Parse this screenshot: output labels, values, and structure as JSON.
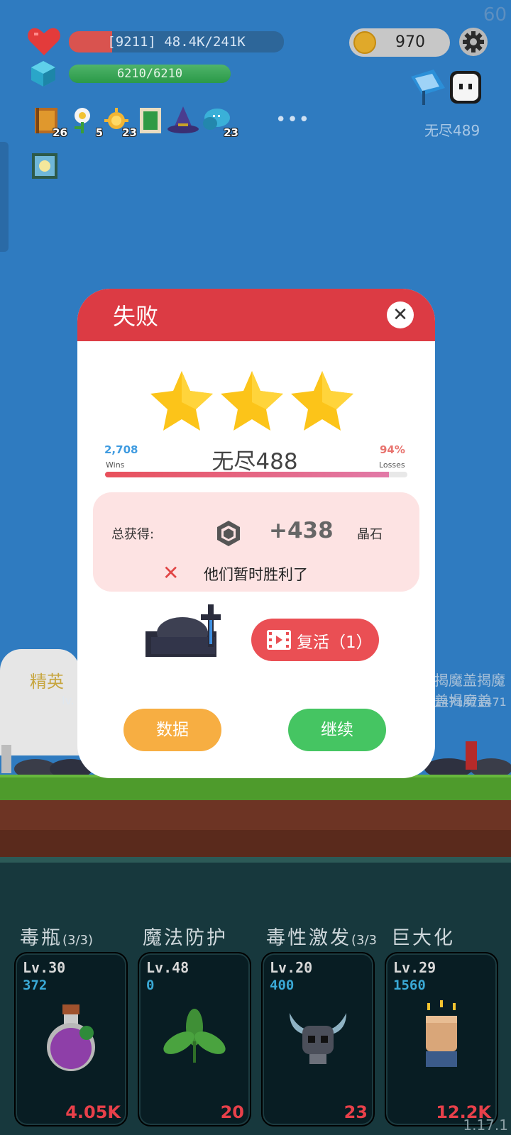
{
  "hud": {
    "fps": "60",
    "hp_text": "[9211] 48.4K/241K",
    "hp_fraction": 0.2,
    "mp_text": "6210/6210",
    "mp_fraction": 1.0,
    "coins": "970",
    "stage": "无尽489",
    "buffs": [
      {
        "icon": "book-icon",
        "count": "26"
      },
      {
        "icon": "flower-icon",
        "count": "5"
      },
      {
        "icon": "sun-icon",
        "count": "23"
      },
      {
        "icon": "card-icon",
        "count": ""
      },
      {
        "icon": "wizard-hat-icon",
        "count": ""
      },
      {
        "icon": "speech-bubble-icon",
        "count": "23"
      },
      {
        "icon": "glowing-tile-icon",
        "count": ""
      }
    ],
    "more": "•••"
  },
  "scene": {
    "elite_label": "精英",
    "lv_label": "lv.",
    "enemy_text": "揭魔盖揭魔盖揭魔盖",
    "enemy_nums": "1471471471"
  },
  "dialog": {
    "title": "失败",
    "stars": 3,
    "wins": "2,708",
    "wins_label": "Wins",
    "loss_pct": "94%",
    "loss_label": "Losses",
    "loss_fraction": 0.94,
    "stage_name": "无尽488",
    "total_label": "总获得:",
    "gem_amount": "+438",
    "gem_unit": "晶石",
    "defeat_msg": "他们暂时胜利了",
    "revive_label": "复活（1）",
    "data_label": "数据",
    "continue_label": "继续"
  },
  "skills": [
    {
      "name": "毒瓶",
      "suffix": "(3/3)",
      "lv": "Lv.30",
      "value": "372",
      "cost": "4.05K",
      "icon": "poison-bottle-icon"
    },
    {
      "name": "魔法防护",
      "suffix": "",
      "lv": "Lv.48",
      "value": "0",
      "cost": "20",
      "icon": "leaf-icon"
    },
    {
      "name": "毒性激发",
      "suffix": "(3/3",
      "lv": "Lv.20",
      "value": "400",
      "cost": "23",
      "icon": "horned-skull-icon"
    },
    {
      "name": "巨大化",
      "suffix": "",
      "lv": "Lv.29",
      "value": "1560",
      "cost": "12.2K",
      "icon": "fist-icon"
    }
  ],
  "version": "1.17.1",
  "colors": {
    "header_red": "#dc3b44",
    "star_yellow": "#fcc419",
    "revive_red": "#ea4f54",
    "data_orange": "#f7ae42",
    "continue_green": "#45c562",
    "cost_red": "#e8404a"
  }
}
